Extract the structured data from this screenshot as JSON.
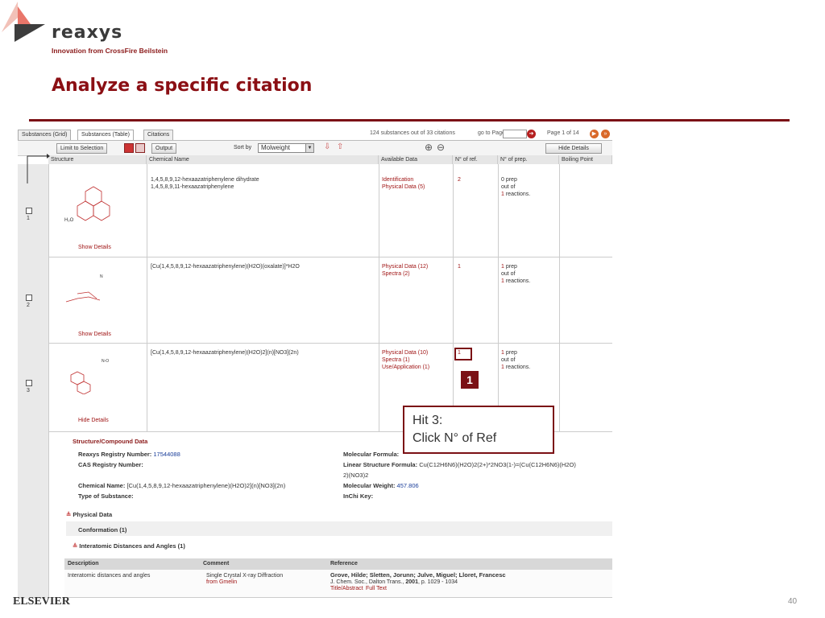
{
  "header": {
    "logo_text": "reaxys",
    "logo_tagline": "Innovation from CrossFire Beilstein",
    "slide_title": "Analyze a specific citation",
    "page_number": "40",
    "footer_brand": "ELSEVIER"
  },
  "tabs": [
    "Substances (Grid)",
    "Substances (Table)",
    "Citations"
  ],
  "status": {
    "summary": "124 substances out of 33 citations",
    "goto": "go to Page",
    "page_info": "Page 1 of 14"
  },
  "toolbar": {
    "limit": "Limit to Selection",
    "output": "Output",
    "sort_by": "Sort by",
    "sort_value": "Molweight",
    "hide_details": "Hide Details"
  },
  "columns": [
    "Structure",
    "Chemical Name",
    "Available Data",
    "N° of ref.",
    "N° of prep.",
    "Boiling Point"
  ],
  "rows": [
    {
      "num": "1",
      "names": [
        "1,4,5,8,9,12-hexaazatriphenylene dihydrate",
        "1,4,5,8,9,11-hexaazatriphenylene"
      ],
      "data": [
        "Identification",
        "Physical Data (5)"
      ],
      "refs": "2",
      "prep": [
        "0 prep",
        "out of",
        "1",
        " reactions."
      ],
      "details": "Show Details"
    },
    {
      "num": "2",
      "names": [
        "[Cu(1,4,5,8,9,12-hexaazatriphenylene)(H2O)(oxalate)]*H2O"
      ],
      "data": [
        "Physical Data (12)",
        "Spectra (2)"
      ],
      "refs": "1",
      "prep": [
        "1",
        " prep",
        "out of",
        "1",
        " reactions."
      ],
      "details": "Show Details"
    },
    {
      "num": "3",
      "names": [
        "[Cu(1,4,5,8,9,12-hexaazatriphenylene)(H2O)2](n)[NO3](2n)"
      ],
      "data": [
        "Physical Data (10)",
        "Spectra (1)",
        "Use/Application (1)"
      ],
      "refs": "1",
      "prep": [
        "1",
        " prep",
        "out of",
        "1",
        " reactions."
      ],
      "details": "Hide Details"
    }
  ],
  "details": {
    "section_title": "Structure/Compound Data",
    "reg_label": "Reaxys Registry Number:",
    "reg_value": "17544088",
    "cas_label": "CAS Registry Number:",
    "chem_label": "Chemical Name:",
    "chem_value": "[Cu(1,4,5,8,9,12-hexaazatriphenylene)(H2O)2](n)[NO3](2n)",
    "type_label": "Type of Substance:",
    "mf_label": "Molecular Formula:",
    "lsf_label": "Linear Structure Formula:",
    "lsf_value": "Cu(C12H6N6)(H2O)2(2+)*2NO3(1-)=(Cu(C12H6N6)(H2O)",
    "lsf_value2": "2)(NO3)2",
    "mw_label": "Molecular Weight:",
    "mw_value": "457.806",
    "inchi_label": "InChi Key:",
    "physical_data": "Physical Data",
    "conformation": "Conformation (1)",
    "interatomic": "Interatomic Distances and Angles (1)",
    "ref_headers": [
      "Description",
      "Comment",
      "Reference"
    ],
    "ref_desc": "Interatomic distances and angles",
    "ref_comment": "Single Crystal X-ray Diffraction",
    "ref_source": "from Gmelin",
    "ref_authors": "Grove, Hilde; Sletten, Jorunn; Julve, Miguel; Lloret, Francesc",
    "ref_journal": "J. Chem. Soc., Dalton Trans.,",
    "ref_year": "2001",
    "ref_pages": ", p. 1029 - 1034",
    "ref_links": [
      "Title/Abstract",
      "Full Text"
    ]
  },
  "callout": {
    "badge": "1",
    "line1": "Hit 3:",
    "line2": "Click N° of Ref"
  }
}
